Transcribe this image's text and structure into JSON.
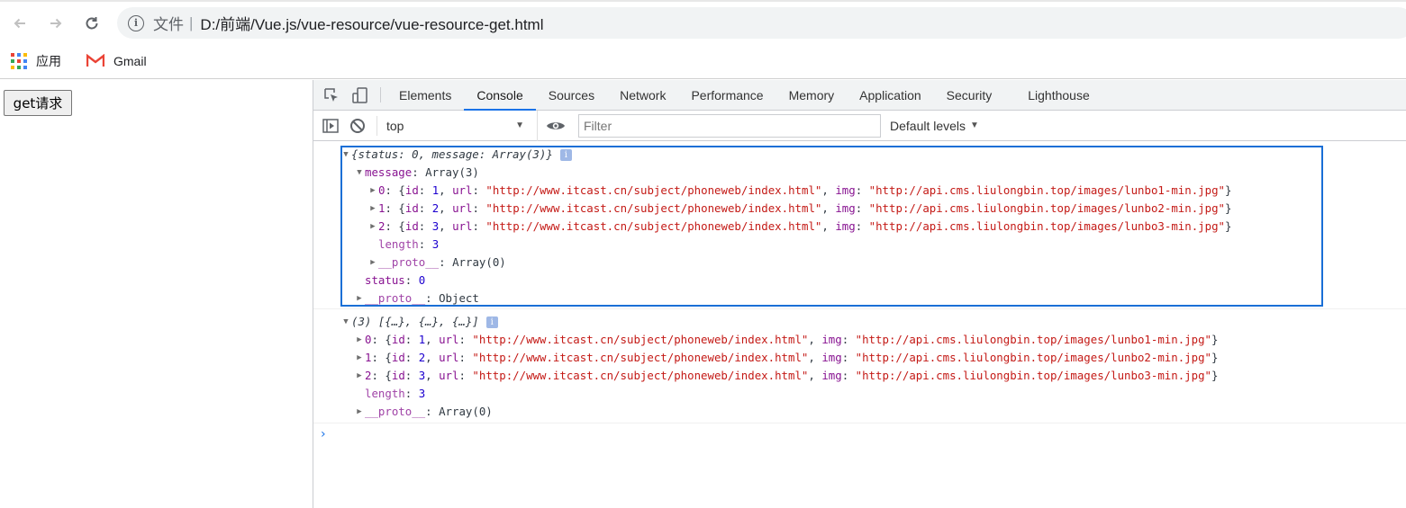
{
  "browser": {
    "scheme_label": "文件",
    "url": "D:/前端/Vue.js/vue-resource/vue-resource-get.html",
    "bookmarks": [
      {
        "label": "应用",
        "icon": "apps-grid-icon"
      },
      {
        "label": "Gmail",
        "icon": "gmail-icon"
      }
    ]
  },
  "page": {
    "get_button_label": "get请求"
  },
  "devtools": {
    "tabs": [
      {
        "label": "Elements"
      },
      {
        "label": "Console",
        "active": true
      },
      {
        "label": "Sources"
      },
      {
        "label": "Network"
      },
      {
        "label": "Performance"
      },
      {
        "label": "Memory"
      },
      {
        "label": "Application"
      },
      {
        "label": "Security"
      },
      {
        "label": "Lighthouse"
      }
    ],
    "context": "top",
    "filter_placeholder": "Filter",
    "levels_label": "Default levels",
    "accent_color": "#1a73e8"
  },
  "console": {
    "msg1": {
      "summary": "{status: 0, message: Array(3)}",
      "message_key": "message",
      "message_val": "Array(3)",
      "items": [
        {
          "index": "0",
          "id": "1",
          "url": "\"http://www.itcast.cn/subject/phoneweb/index.html\"",
          "img": "\"http://api.cms.liulongbin.top/images/lunbo1-min.jpg\""
        },
        {
          "index": "1",
          "id": "2",
          "url": "\"http://www.itcast.cn/subject/phoneweb/index.html\"",
          "img": "\"http://api.cms.liulongbin.top/images/lunbo2-min.jpg\""
        },
        {
          "index": "2",
          "id": "3",
          "url": "\"http://www.itcast.cn/subject/phoneweb/index.html\"",
          "img": "\"http://api.cms.liulongbin.top/images/lunbo3-min.jpg\""
        }
      ],
      "length_key": "length",
      "length_val": "3",
      "array_proto_key": "__proto__",
      "array_proto_val": "Array(0)",
      "status_key": "status",
      "status_val": "0",
      "object_proto_key": "__proto__",
      "object_proto_val": "Object"
    },
    "msg2": {
      "summary": "(3) [{…}, {…}, {…}]",
      "items": [
        {
          "index": "0",
          "id": "1",
          "url": "\"http://www.itcast.cn/subject/phoneweb/index.html\"",
          "img": "\"http://api.cms.liulongbin.top/images/lunbo1-min.jpg\""
        },
        {
          "index": "1",
          "id": "2",
          "url": "\"http://www.itcast.cn/subject/phoneweb/index.html\"",
          "img": "\"http://api.cms.liulongbin.top/images/lunbo2-min.jpg\""
        },
        {
          "index": "2",
          "id": "3",
          "url": "\"http://www.itcast.cn/subject/phoneweb/index.html\"",
          "img": "\"http://api.cms.liulongbin.top/images/lunbo3-min.jpg\""
        }
      ],
      "length_key": "length",
      "length_val": "3",
      "proto_key": "__proto__",
      "proto_val": "Array(0)"
    },
    "labels": {
      "id_key": "id",
      "url_key": "url",
      "img_key": "img",
      "info_glyph": "i",
      "prompt": "›"
    }
  }
}
